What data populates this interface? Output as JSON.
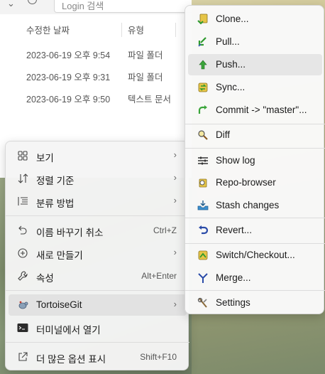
{
  "explorer": {
    "search_placeholder": "Login 검색",
    "columns": {
      "date": "수정한 날짜",
      "type": "유형"
    },
    "rows": [
      {
        "date": "2023-06-19 오후 9:54",
        "type": "파일 폴더"
      },
      {
        "date": "2023-06-19 오후 9:31",
        "type": "파일 폴더"
      },
      {
        "date": "2023-06-19 오후 9:50",
        "type": "텍스트 문서"
      }
    ]
  },
  "context_menu": {
    "items": [
      {
        "label": "보기",
        "shortcut": "",
        "submenu": true,
        "icon": "grid-view-icon"
      },
      {
        "label": "정렬 기준",
        "shortcut": "",
        "submenu": true,
        "icon": "sort-icon"
      },
      {
        "label": "분류 방법",
        "shortcut": "",
        "submenu": true,
        "icon": "group-by-icon"
      },
      {
        "label": "이름 바꾸기 취소",
        "shortcut": "Ctrl+Z",
        "submenu": false,
        "icon": "undo-icon"
      },
      {
        "label": "새로 만들기",
        "shortcut": "",
        "submenu": true,
        "icon": "new-icon"
      },
      {
        "label": "속성",
        "shortcut": "Alt+Enter",
        "submenu": false,
        "icon": "wrench-icon"
      },
      {
        "label": "TortoiseGit",
        "shortcut": "",
        "submenu": true,
        "icon": "tortoisegit-icon",
        "selected": true
      },
      {
        "label": "터미널에서 열기",
        "shortcut": "",
        "submenu": false,
        "icon": "terminal-icon"
      },
      {
        "label": "더 많은 옵션 표시",
        "shortcut": "Shift+F10",
        "submenu": false,
        "icon": "share-icon"
      }
    ]
  },
  "tortoisegit_menu": {
    "items": [
      {
        "label": "Clone...",
        "icon": "clone-icon"
      },
      {
        "label": "Pull...",
        "icon": "pull-icon"
      },
      {
        "label": "Push...",
        "icon": "push-icon",
        "hover": true
      },
      {
        "label": "Sync...",
        "icon": "sync-icon"
      },
      {
        "label": "Commit -> \"master\"...",
        "icon": "commit-icon"
      },
      {
        "label": "Diff",
        "icon": "diff-icon"
      },
      {
        "label": "Show log",
        "icon": "log-icon"
      },
      {
        "label": "Repo-browser",
        "icon": "repo-browser-icon"
      },
      {
        "label": "Stash changes",
        "icon": "stash-icon"
      },
      {
        "label": "Revert...",
        "icon": "revert-icon"
      },
      {
        "label": "Switch/Checkout...",
        "icon": "switch-icon"
      },
      {
        "label": "Merge...",
        "icon": "merge-icon"
      },
      {
        "label": "Settings",
        "icon": "settings-icon"
      }
    ]
  },
  "colors": {
    "menu_bg": "#f5f5f5",
    "submenu_bg": "#f9f9f9",
    "hover": "#e6e6e6",
    "selected": "#e2e2e2"
  }
}
